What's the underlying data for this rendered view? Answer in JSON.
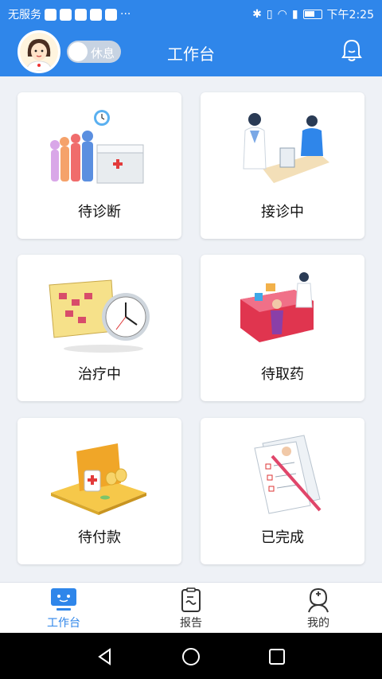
{
  "status_bar": {
    "carrier": "无服务",
    "more": "···",
    "time": "下午2:25"
  },
  "header": {
    "toggle_label": "休息",
    "title": "工作台"
  },
  "cards": [
    {
      "label": "待诊断",
      "icon": "waiting-diagnosis-icon"
    },
    {
      "label": "接诊中",
      "icon": "consulting-icon"
    },
    {
      "label": "治疗中",
      "icon": "in-treatment-icon"
    },
    {
      "label": "待取药",
      "icon": "pickup-medicine-icon"
    },
    {
      "label": "待付款",
      "icon": "payment-icon"
    },
    {
      "label": "已完成",
      "icon": "completed-icon"
    }
  ],
  "bottom_nav": [
    {
      "label": "工作台",
      "active": true
    },
    {
      "label": "报告",
      "active": false
    },
    {
      "label": "我的",
      "active": false
    }
  ],
  "colors": {
    "primary": "#2f86ea",
    "background": "#eef1f6"
  }
}
